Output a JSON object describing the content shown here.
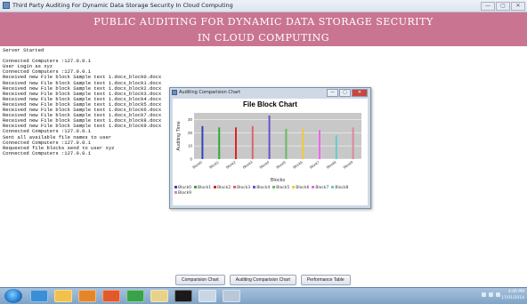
{
  "window": {
    "title": "Third Party Auditing For Dynamic Data Storage Security In Cloud Computing",
    "buttons": [
      "—",
      "▢",
      "✕"
    ]
  },
  "banner": {
    "line1": "PUBLIC AUDITING FOR DYNAMIC DATA STORAGE SECURITY",
    "line2": "IN CLOUD COMPUTING",
    "color": "#c97592"
  },
  "console_lines": [
    "Server Started",
    "",
    "Connected Computers :127.0.0.1",
    "User Login as xyz",
    "Connected Computers :127.0.0.1",
    "Received new File block Sample text 1.docx_block0.docx",
    "Received new File block Sample text 1.docx_block1.docx",
    "Received new File block Sample text 1.docx_block2.docx",
    "Received new File block Sample text 1.docx_block3.docx",
    "Received new File block Sample text 1.docx_block4.docx",
    "Received new File block Sample text 1.docx_block5.docx",
    "Received new File block Sample text 1.docx_block6.docx",
    "Received new File block Sample text 1.docx_block7.docx",
    "Received new File block Sample text 1.docx_block8.docx",
    "Received new File block Sample text 1.docx_block9.docx",
    "Connected Computers :127.0.0.1",
    "Sent all available file names to user",
    "Connected Computers :127.0.0.1",
    "Requested file blocks send to user xyz",
    "Connected Computers :127.0.0.1"
  ],
  "popup": {
    "title": "Auditing Comparision Chart",
    "buttons": [
      "—",
      "▢",
      "✕"
    ]
  },
  "chart_data": {
    "type": "bar",
    "title": "File Block Chart",
    "xlabel": "Blocks",
    "ylabel": "Auditing Time",
    "ylim": [
      0,
      35
    ],
    "yticks": [
      0,
      10,
      20,
      30
    ],
    "categories": [
      "Block0",
      "Block1",
      "Block2",
      "Block3",
      "Block4",
      "Block5",
      "Block6",
      "Block7",
      "Block8",
      "Block9"
    ],
    "values": [
      25,
      24,
      24,
      25,
      33,
      23,
      23,
      22,
      18,
      24
    ],
    "colors": [
      "#3344bb",
      "#33aa33",
      "#dd2222",
      "#dd6666",
      "#6655cc",
      "#66bb66",
      "#eecc33",
      "#ee66ee",
      "#66cccc",
      "#dd8899"
    ],
    "legend": [
      "Block0",
      "Block1",
      "Block2",
      "Block3",
      "Block4",
      "Block5",
      "Block6",
      "Block7",
      "Block8",
      "Block9"
    ],
    "plot_background": "#c8c8c8",
    "grid": true
  },
  "bottom_buttons": [
    "Comparision Chart",
    "Auditing Comparision Chart",
    "Performance Table"
  ],
  "taskbar": {
    "time": "4:00 PM",
    "date": "17/01/2014",
    "apps": [
      "ie-icon",
      "folder-icon",
      "media-icon",
      "firefox-icon",
      "chrome-icon",
      "files-icon",
      "cmd-icon",
      "java-icon",
      "window-icon"
    ],
    "app_colors": [
      "#3a8fd6",
      "#f0c24a",
      "#e3862b",
      "#e2592a",
      "#3aa34a",
      "#e8d28a",
      "#1a1a1a",
      "#c9d6e6",
      "#b9c8d9"
    ]
  }
}
